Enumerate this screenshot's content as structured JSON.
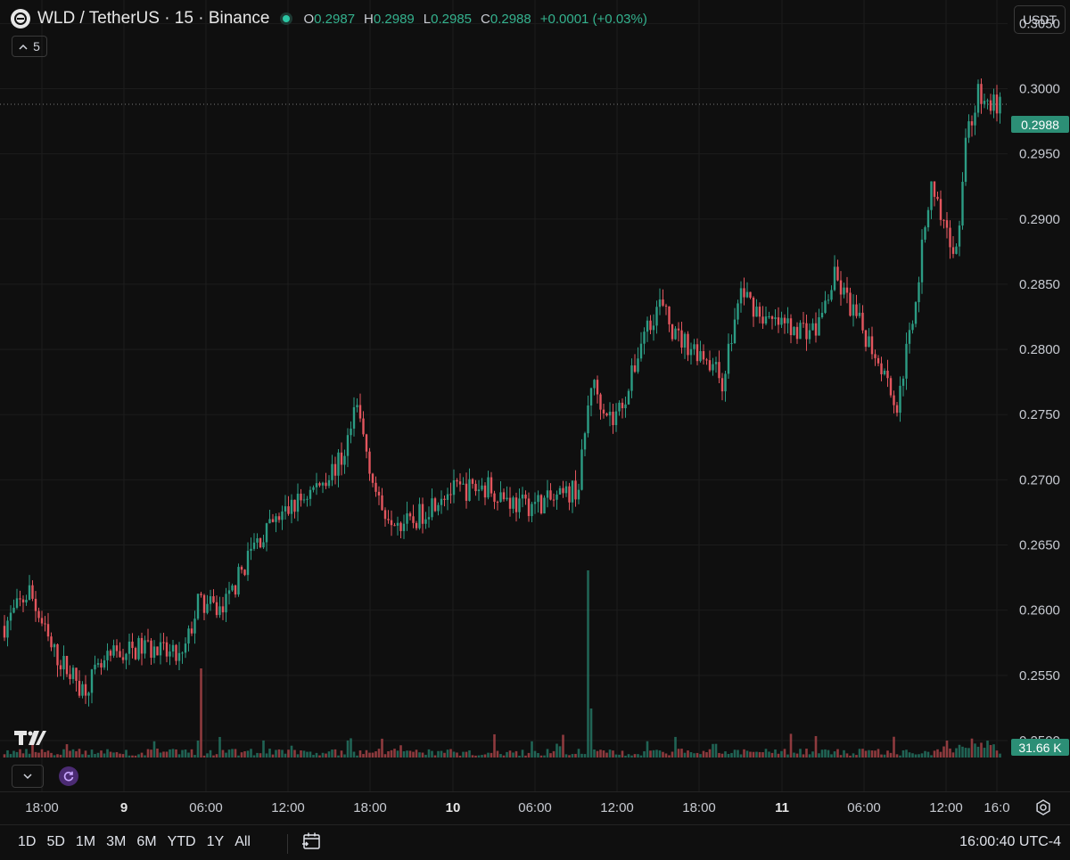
{
  "header": {
    "symbol_title": "WLD / TetherUS · 15 · Binance",
    "ohlc": [
      {
        "key": "O",
        "value": "0.2987"
      },
      {
        "key": "H",
        "value": "0.2989"
      },
      {
        "key": "L",
        "value": "0.2985"
      },
      {
        "key": "C",
        "value": "0.2988"
      }
    ],
    "change": "+0.0001 (+0.03%)"
  },
  "indicator_count": "5",
  "currency": "USDT",
  "price_axis": [
    "0.3050",
    "0.3000",
    "0.2950",
    "0.2900",
    "0.2850",
    "0.2800",
    "0.2750",
    "0.2700",
    "0.2650",
    "0.2600",
    "0.2550",
    "0.2500"
  ],
  "last_price_label": "0.2988",
  "volume_label": "31.66 K",
  "time_axis": [
    {
      "label": "18:00",
      "bold": false
    },
    {
      "label": "9",
      "bold": true
    },
    {
      "label": "06:00",
      "bold": false
    },
    {
      "label": "12:00",
      "bold": false
    },
    {
      "label": "18:00",
      "bold": false
    },
    {
      "label": "10",
      "bold": true
    },
    {
      "label": "06:00",
      "bold": false
    },
    {
      "label": "12:00",
      "bold": false
    },
    {
      "label": "18:00",
      "bold": false
    },
    {
      "label": "11",
      "bold": true
    },
    {
      "label": "06:00",
      "bold": false
    },
    {
      "label": "12:00",
      "bold": false
    },
    {
      "label": "16:0",
      "bold": false
    }
  ],
  "date_ranges": [
    "1D",
    "5D",
    "1M",
    "3M",
    "6M",
    "YTD",
    "1Y",
    "All"
  ],
  "clock": "16:00:40 UTC-4",
  "colors": {
    "up": "#2c9c84",
    "down": "#e3565e",
    "background": "#0f0f0f"
  },
  "icons": [
    "wld-logo-icon",
    "status-dot-icon",
    "chevron-up-icon",
    "chevron-down-icon",
    "refresh-icon",
    "settings-gear-icon",
    "calendar-goto-icon",
    "tradingview-logo-icon"
  ],
  "chart_data": {
    "type": "candlestick",
    "interval": "15",
    "ylim": [
      0.2487,
      0.3068
    ],
    "last_price": 0.2988,
    "anchors": [
      [
        0,
        0.2588
      ],
      [
        8,
        0.2615
      ],
      [
        15,
        0.257
      ],
      [
        25,
        0.254
      ],
      [
        35,
        0.2565
      ],
      [
        45,
        0.2572
      ],
      [
        57,
        0.2562
      ],
      [
        62,
        0.2605
      ],
      [
        70,
        0.26
      ],
      [
        80,
        0.265
      ],
      [
        90,
        0.2675
      ],
      [
        100,
        0.2695
      ],
      [
        108,
        0.2715
      ],
      [
        113,
        0.2755
      ],
      [
        120,
        0.268
      ],
      [
        130,
        0.2665
      ],
      [
        140,
        0.269
      ],
      [
        155,
        0.2695
      ],
      [
        165,
        0.268
      ],
      [
        178,
        0.2685
      ],
      [
        184,
        0.2695
      ],
      [
        188,
        0.2775
      ],
      [
        195,
        0.2745
      ],
      [
        200,
        0.277
      ],
      [
        205,
        0.2815
      ],
      [
        210,
        0.2835
      ],
      [
        215,
        0.281
      ],
      [
        225,
        0.2795
      ],
      [
        230,
        0.2775
      ],
      [
        236,
        0.2845
      ],
      [
        245,
        0.282
      ],
      [
        260,
        0.2815
      ],
      [
        266,
        0.2855
      ],
      [
        275,
        0.2815
      ],
      [
        282,
        0.2785
      ],
      [
        286,
        0.2755
      ],
      [
        292,
        0.284
      ],
      [
        297,
        0.293
      ],
      [
        302,
        0.2885
      ],
      [
        305,
        0.2875
      ],
      [
        308,
        0.296
      ],
      [
        312,
        0.2995
      ],
      [
        314,
        0.2988
      ]
    ],
    "volume_spikes": [
      {
        "index": 63,
        "value": 100
      },
      {
        "index": 187,
        "value": 210
      },
      {
        "index": 188,
        "value": 55
      }
    ]
  }
}
